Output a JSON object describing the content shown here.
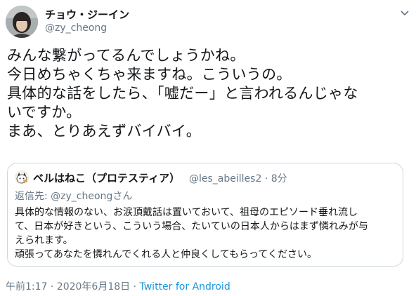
{
  "author": {
    "display_name": "チョウ・ジーイン",
    "handle": "@zy_cheong"
  },
  "tweet": {
    "lines": [
      "みんな繋がってるんでしょうかね。",
      "今日めちゃくちゃ来ますね。こういうの。",
      "具体的な話をしたら、「嘘だー」と言われるんじゃな",
      "いですか。",
      "まあ、とりあえずバイバイ。"
    ]
  },
  "quoted": {
    "display_name": "ベルはねこ（プロテスティア）",
    "handle": "@les_abeilles2",
    "separator": "·",
    "time": "8分",
    "reply_prefix": "返信先: ",
    "reply_mention": "@zy_cheong",
    "reply_suffix": "さん",
    "lines": [
      "具体的な情報のない、お涙頂戴話は置いておいて、祖母のエピソード垂れ流し",
      "て、日本が好きという、こういう場合、たいていの日本人からはまず憐れみが与",
      "えられます。",
      "頑張ってあなたを憐れんでくれる人と仲良くしてもらってください。"
    ]
  },
  "footer": {
    "timestamp": "午前1:17 · 2020年6月18日 · ",
    "source": "Twitter for Android"
  },
  "icons": {
    "avatar": "avatar",
    "quoted_avatar": "avatar",
    "menu": "chevron-down-icon"
  },
  "colors": {
    "text": "#14171a",
    "secondary": "#657786",
    "link": "#1b95e0",
    "border": "#ccd6dd"
  }
}
